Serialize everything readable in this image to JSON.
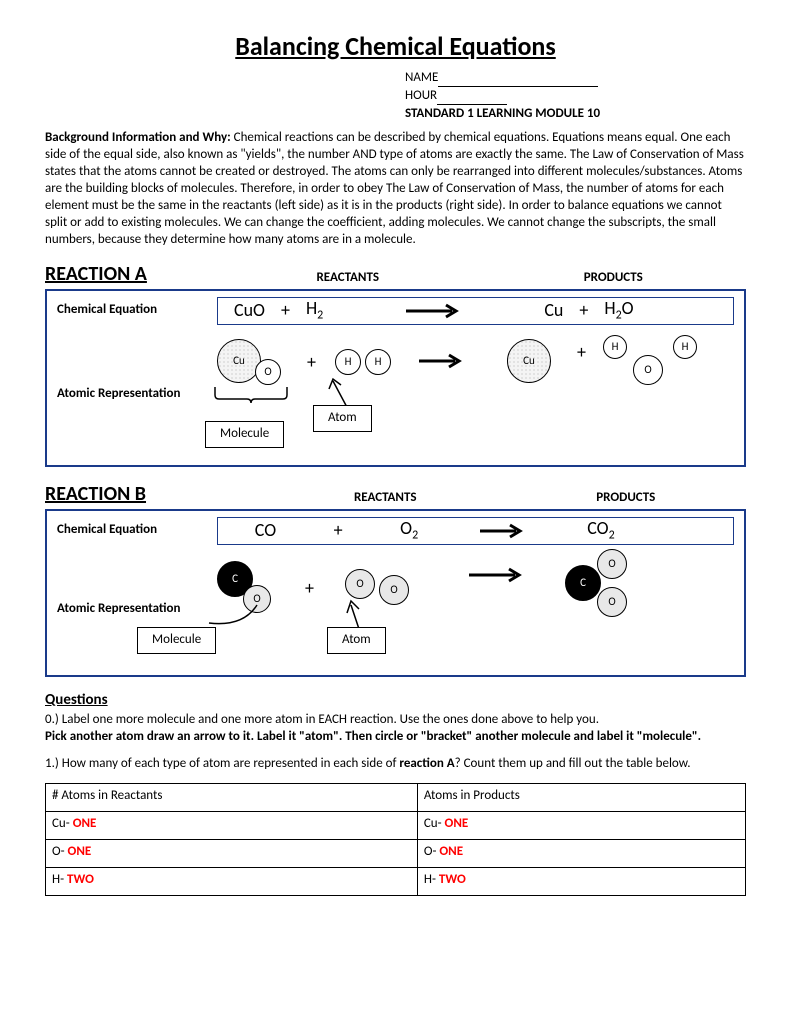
{
  "title": "Balancing Chemical Equations",
  "header": {
    "name_label": "NAME",
    "hour_label": "HOUR",
    "standard": "STANDARD 1 LEARNING MODULE 10"
  },
  "background": {
    "lead": "Background Information and Why:",
    "body": " Chemical reactions can be described by chemical equations. Equations means equal. One each side of the equal side, also known as \"yields\", the number AND type of atoms are exactly the same. The Law of Conservation of Mass states that the atoms cannot be created or destroyed. The atoms can only be rearranged into different molecules/substances. Atoms are the building blocks of molecules. Therefore, in order to obey The Law of Conservation of Mass, the number of atoms for each element must be the same in the reactants (left side) as it is in the products (right side). In order to balance equations we cannot split or add to existing molecules. We can change the coefficient, adding molecules. We cannot change the subscripts, the small numbers, because they determine how many atoms are in a molecule."
  },
  "labels": {
    "reactants": "REACTANTS",
    "products": "PRODUCTS",
    "chem_eq": "Chemical Equation",
    "atomic_rep": "Atomic Representation",
    "molecule": "Molecule",
    "atom": "Atom"
  },
  "reactionA": {
    "heading": "REACTION A",
    "eq": {
      "r1": "CuO",
      "r2_base": "H",
      "r2_sub": "2",
      "p1": "Cu",
      "p2_base": "H",
      "p2_sub": "2",
      "p2_tail": "O"
    },
    "atoms": {
      "cu": "Cu",
      "o": "O",
      "h": "H"
    }
  },
  "reactionB": {
    "heading": "REACTION B",
    "eq": {
      "r1": "CO",
      "r2_base": "O",
      "r2_sub": "2",
      "p1_base": "CO",
      "p1_sub": "2"
    },
    "atoms": {
      "c": "C",
      "o": "O"
    }
  },
  "questions": {
    "heading": "Questions",
    "q0a": "0.) Label one more molecule and one more atom in EACH reaction. Use the ones done above to help you.",
    "q0b": "Pick another atom draw an arrow to it. Label it \"atom\". Then circle or \"bracket\" another molecule and label it \"molecule\".",
    "q1_lead": "1.) How many of each type of atom are represented in each side of ",
    "q1_bold": "reaction A",
    "q1_tail": "? Count them up and fill out the table below.",
    "table": {
      "h1": "# Atoms in Reactants",
      "h2": "Atoms in Products",
      "rows": [
        {
          "l_label": "Cu- ",
          "l_val": "ONE",
          "r_label": "Cu- ",
          "r_val": "ONE"
        },
        {
          "l_label": "O- ",
          "l_val": "ONE",
          "r_label": "O- ",
          "r_val": "ONE"
        },
        {
          "l_label": "H- ",
          "l_val": "TWO",
          "r_label": "H- ",
          "r_val": "TWO"
        }
      ]
    }
  }
}
